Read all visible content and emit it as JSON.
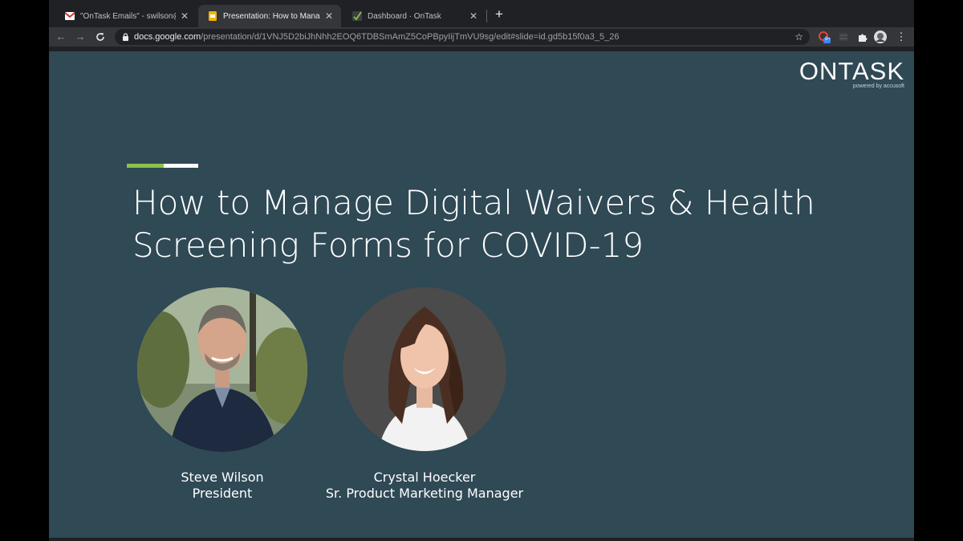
{
  "tabs": [
    {
      "title": "\"OnTask Emails\" - swilson@acc",
      "icon": "gmail-icon",
      "active": false
    },
    {
      "title": "Presentation: How to Manage D",
      "icon": "google-slides-icon",
      "active": true
    },
    {
      "title": "Dashboard · OnTask",
      "icon": "ontask-check-icon",
      "active": false
    }
  ],
  "toolbar": {
    "url_host": "docs.google.com",
    "url_path": "/presentation/d/1VNJ5D2biJhNhh2EOQ6TDBSmAmZ5CoPBpyIijTmVU9sg/edit#slide=id.gd5b15f0a3_5_26",
    "extension_badge": "9+"
  },
  "slide": {
    "logo_text": "ONTASK",
    "logo_subtitle": "powered by accusoft",
    "title_line1": "How to Manage Digital Waivers & Health",
    "title_line2": "Screening Forms for COVID-19",
    "speakers": [
      {
        "name": "Steve Wilson",
        "role": "President"
      },
      {
        "name": "Crystal Hoecker",
        "role": "Sr. Product Marketing Manager"
      }
    ]
  },
  "colors": {
    "slide_background": "#2f4955",
    "accent_green": "#8bc34a",
    "chrome_dark": "#202124",
    "chrome_toolbar": "#35363a"
  }
}
